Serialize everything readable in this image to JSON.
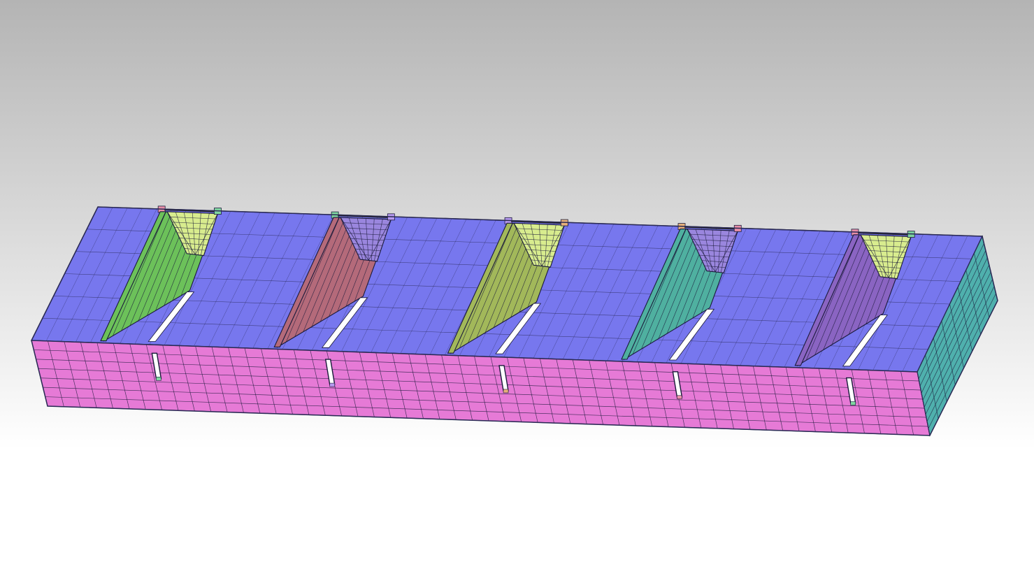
{
  "viewport": {
    "background_top": "#b4b4b4",
    "background_bottom": "#ffffff"
  },
  "model": {
    "pocket_count": 5,
    "colors": {
      "top_surface": "#7777ee",
      "front_face": "#e67ad6",
      "side_face": "#4fb0ad",
      "mesh_line": "#1a1a3a",
      "wall_left": [
        "#6cc15a",
        "#b46a7a",
        "#a2b85a",
        "#4fb0a0",
        "#8a64c2"
      ],
      "wall_right": [
        "#d8ec8e",
        "#9a86de",
        "#d8ec8e",
        "#9a86de",
        "#d8ec8e"
      ],
      "slot_fill": "#ffffff",
      "marker_colors": [
        "#e88fa8",
        "#7fd6a0",
        "#b79af0",
        "#e6b07a"
      ]
    }
  }
}
